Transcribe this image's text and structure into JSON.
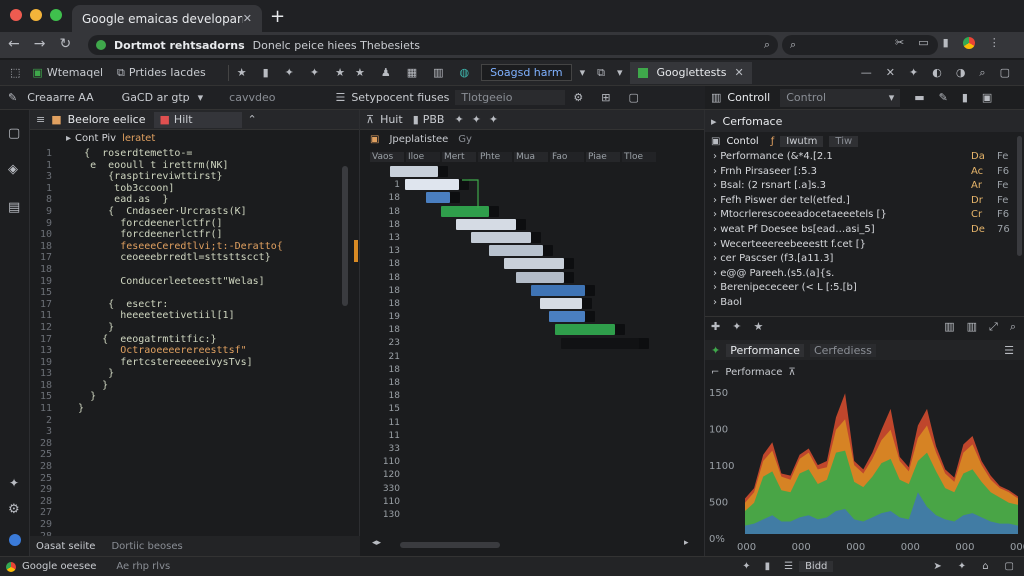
{
  "browser": {
    "tab_title": "Google emaicas developarmis",
    "new_tab": "+",
    "url_bold": "Dortmot rehtsadorns",
    "url_rest": "Donelc peice hiees Thebesiets"
  },
  "toolbar1": {
    "items": [
      "Wtemaqel",
      "Prtides Iacdes"
    ],
    "search_chip": "Soagsd harm",
    "right_tab": "Googlettests"
  },
  "toolbar2": {
    "left": [
      "Creaarre AA",
      "GaCD ar gtp",
      "cavvdeo"
    ],
    "middle": [
      "Setypocent fiuses",
      "Tlotgeeio"
    ],
    "control_label": "Controll",
    "control_select": "Control"
  },
  "editor": {
    "header": "Beelore eelice",
    "chip": "Hilt",
    "subheader": "Cont Piv",
    "subheader_accent": "leratet",
    "lines": [
      {
        "n": "1",
        "t": "    {  roserdtemetto-=",
        "c": "teal"
      },
      {
        "n": "1",
        "t": "     e  eooull t irettrm(NK]",
        "c": "teal"
      },
      {
        "n": "3",
        "t": "        {rasptireviwttirst}",
        "c": "teal"
      },
      {
        "n": "1",
        "t": "         tob3ccoon]",
        "c": "teal"
      },
      {
        "n": "8",
        "t": "         ead.as  }",
        "c": "teal"
      },
      {
        "n": "9",
        "t": "        {  Cndaseer·Urcrasts(K]",
        "c": "teal"
      },
      {
        "n": "9",
        "t": "          forcdeenerlctfr(]",
        "c": "teal"
      },
      {
        "n": "10",
        "t": "          forcdeenerlctfr(]",
        "c": "teal"
      },
      {
        "n": "18",
        "t": "          feseeeCeredtlvi;t:-Deratto{",
        "c": "orange"
      },
      {
        "n": "17",
        "t": "          ceoeeebrredtl=sttsttscct}",
        "c": "teal"
      },
      {
        "n": "18",
        "t": "",
        "c": "teal"
      },
      {
        "n": "19",
        "t": "          Conducerleeteestt\"Welas]",
        "c": "teal"
      },
      {
        "n": "15",
        "t": "",
        "c": "teal"
      },
      {
        "n": "17",
        "t": "        {  esectr:",
        "c": "teal"
      },
      {
        "n": "11",
        "t": "          heeeeteetivetiil[1]",
        "c": "teal"
      },
      {
        "n": "12",
        "t": "        }",
        "c": "teal"
      },
      {
        "n": "17",
        "t": "       {  eeogatrmtitfic:}",
        "c": "teal"
      },
      {
        "n": "13",
        "t": "          Octraoeeeerereesttsf\"",
        "c": "orange"
      },
      {
        "n": "19",
        "t": "          fertcstereeeeeivysTvs]",
        "c": "teal"
      },
      {
        "n": "13",
        "t": "        }",
        "c": "teal"
      },
      {
        "n": "18",
        "t": "       }",
        "c": "teal"
      },
      {
        "n": "15",
        "t": "     }",
        "c": "teal"
      },
      {
        "n": "11",
        "t": "   }",
        "c": "teal"
      },
      {
        "n": "2",
        "t": "",
        "c": "teal"
      },
      {
        "n": "3",
        "t": "",
        "c": "teal"
      },
      {
        "n": "28",
        "t": "",
        "c": "teal"
      },
      {
        "n": "25",
        "t": "",
        "c": "teal"
      },
      {
        "n": "28",
        "t": "",
        "c": "teal"
      },
      {
        "n": "25",
        "t": "",
        "c": "teal"
      },
      {
        "n": "29",
        "t": "",
        "c": "teal"
      },
      {
        "n": "28",
        "t": "",
        "c": "teal"
      },
      {
        "n": "27",
        "t": "",
        "c": "teal"
      },
      {
        "n": "29",
        "t": "",
        "c": "teal"
      },
      {
        "n": "28",
        "t": "",
        "c": "teal"
      }
    ],
    "footer_tabs": [
      "Oasat seiite",
      "Dortiic beoses"
    ]
  },
  "timeline": {
    "header_left": "Huit",
    "header_mid": "PBB",
    "sub_left": "Jpeplatistee",
    "sub_right": "Gy",
    "columns": [
      "Vaos",
      "Iloe",
      "Mert",
      "Phte",
      "Mua",
      "Fao",
      "Piae",
      "Tloe"
    ],
    "row_labels": [
      "1",
      "1",
      "18",
      "18",
      "18",
      "13",
      "13",
      "18",
      "18",
      "18",
      "18",
      "19",
      "18",
      "23",
      "21",
      "18",
      "18",
      "18",
      "15",
      "11",
      "11",
      "33",
      "110",
      "120",
      "330",
      "110",
      "130"
    ],
    "bars": [
      {
        "start": 0.0,
        "dur": 0.16,
        "color": "#c8d0da"
      },
      {
        "start": 0.05,
        "dur": 0.18,
        "color": "#dfe5ee"
      },
      {
        "start": 0.12,
        "dur": 0.08,
        "color": "#4a7fc1"
      },
      {
        "start": 0.17,
        "dur": 0.16,
        "color": "#2f9e4b"
      },
      {
        "start": 0.22,
        "dur": 0.2,
        "color": "#d5dbe4"
      },
      {
        "start": 0.27,
        "dur": 0.2,
        "color": "#c4ccd6"
      },
      {
        "start": 0.33,
        "dur": 0.18,
        "color": "#b8c2ce"
      },
      {
        "start": 0.38,
        "dur": 0.2,
        "color": "#c9d0d9"
      },
      {
        "start": 0.42,
        "dur": 0.16,
        "color": "#b3bcc8"
      },
      {
        "start": 0.47,
        "dur": 0.18,
        "color": "#3f74b5"
      },
      {
        "start": 0.5,
        "dur": 0.14,
        "color": "#d6dce4"
      },
      {
        "start": 0.53,
        "dur": 0.12,
        "color": "#4a7fc1"
      },
      {
        "start": 0.55,
        "dur": 0.2,
        "color": "#2f9e4b"
      },
      {
        "start": 0.57,
        "dur": 0.26,
        "color": "#111214"
      }
    ]
  },
  "right": {
    "performance_header": "Cerfomace",
    "tabs": [
      "Contol",
      "Iwutm",
      "Tiw"
    ],
    "rows": [
      {
        "k": "Performance (&*4.[2.1",
        "v1": "Da",
        "v2": "Fe"
      },
      {
        "k": "Frnh Pirsaseer [:5.3",
        "v1": "Ac",
        "v2": "F6"
      },
      {
        "k": "Bsal: (2 rsnart [.a]s.3",
        "v1": "Ar",
        "v2": "Fe"
      },
      {
        "k": "Fefh Piswer der tel(etfed.]",
        "v1": "Dr",
        "v2": "Fe"
      },
      {
        "k": "Mtocrlerescoeeadocetaeeetels [}",
        "v1": "Cr",
        "v2": "F6"
      },
      {
        "k": "weat Pf Doesee bs[ead…asi_5]",
        "v1": "De",
        "v2": "76"
      },
      {
        "k": "Wecerteeereebeeestt f.cet [}",
        "v1": "",
        "v2": ""
      },
      {
        "k": "cer Pascser (f3.[a11.3]",
        "v1": "",
        "v2": ""
      },
      {
        "k": "e@@ Pareeh.(s5.(a]{s.",
        "v1": "",
        "v2": ""
      },
      {
        "k": "Berenipececeer (< L [:5.[b]",
        "v1": "",
        "v2": ""
      },
      {
        "k": "Baol",
        "v1": "",
        "v2": ""
      }
    ],
    "perf_tab": "Performance",
    "perf_tab2": "Cerfediess",
    "perf_sub": "Performace",
    "chart": {
      "y_ticks": [
        "150",
        "100",
        "1100",
        "500",
        "0%"
      ],
      "x_ticks": [
        "000",
        "000",
        "000",
        "000",
        "000",
        "000"
      ]
    }
  },
  "status": {
    "left": "Google oeesee",
    "left2": "Ae rhp rlvs",
    "right": "Bidd"
  },
  "chart_data": {
    "type": "area",
    "title": "",
    "xlabel": "",
    "ylabel": "",
    "y_tick_labels": [
      "150",
      "100",
      "1100",
      "500",
      "0%"
    ],
    "x_tick_labels": [
      "000",
      "000",
      "000",
      "000",
      "000",
      "000"
    ],
    "x": [
      0,
      1,
      2,
      3,
      4,
      5,
      6,
      7,
      8,
      9,
      10,
      11,
      12,
      13,
      14,
      15,
      16,
      17,
      18,
      19,
      20,
      21,
      22,
      23,
      24,
      25,
      26,
      27,
      28,
      29,
      30
    ],
    "series": [
      {
        "color": "#3aa84a",
        "values": [
          22,
          30,
          55,
          60,
          42,
          40,
          58,
          62,
          48,
          52,
          78,
          80,
          50,
          45,
          55,
          68,
          72,
          52,
          48,
          70,
          78,
          60,
          44,
          40,
          58,
          62,
          50,
          40,
          35,
          30,
          28
        ]
      },
      {
        "color": "#d88a24",
        "values": [
          30,
          40,
          70,
          80,
          55,
          52,
          72,
          78,
          62,
          64,
          100,
          110,
          66,
          58,
          72,
          90,
          100,
          70,
          60,
          92,
          104,
          78,
          58,
          50,
          78,
          86,
          66,
          52,
          44,
          40,
          34
        ]
      },
      {
        "color": "#d24a2e",
        "values": [
          34,
          44,
          76,
          88,
          58,
          56,
          76,
          82,
          66,
          70,
          112,
          135,
          70,
          62,
          78,
          100,
          120,
          74,
          64,
          104,
          120,
          84,
          62,
          54,
          86,
          94,
          70,
          56,
          46,
          42,
          36
        ]
      },
      {
        "color": "#3f74b5",
        "values": [
          8,
          10,
          14,
          18,
          12,
          12,
          16,
          18,
          14,
          16,
          22,
          24,
          14,
          12,
          16,
          20,
          22,
          16,
          14,
          40,
          26,
          18,
          14,
          12,
          18,
          20,
          16,
          12,
          10,
          10,
          8
        ]
      }
    ]
  }
}
